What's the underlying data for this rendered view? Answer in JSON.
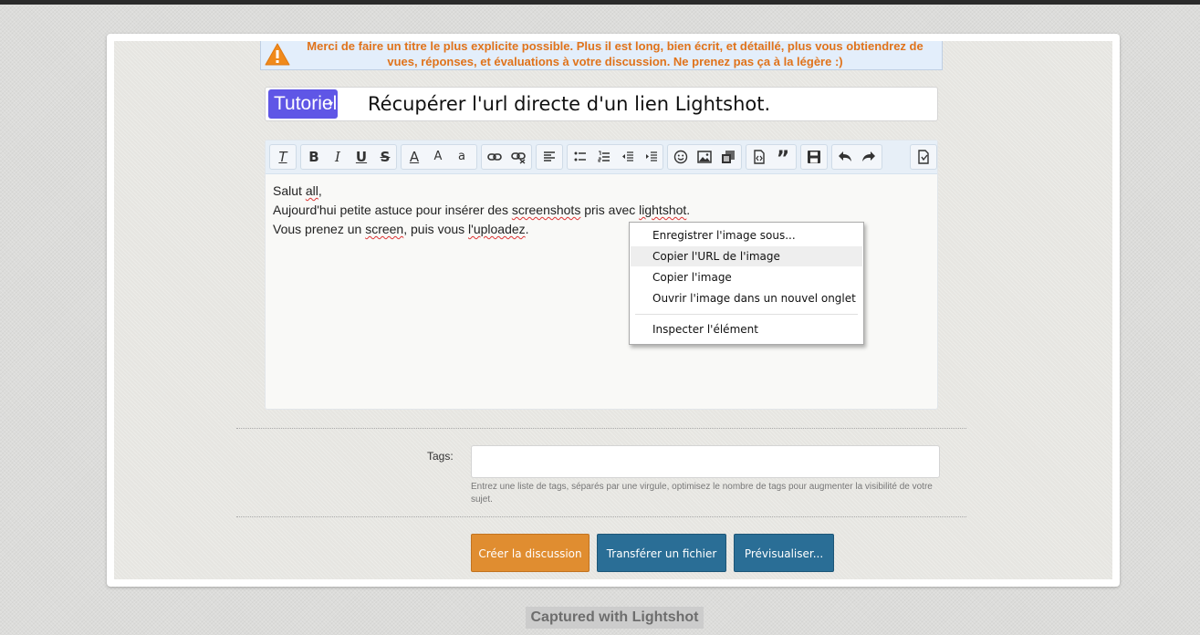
{
  "warning": {
    "icon": "warning-triangle-icon",
    "line1": "Merci de faire un titre le plus explicite possible. Plus il est long, bien écrit, et détaillé, plus vous obtiendrez de",
    "line2": "vues, réponses, et évaluations à votre discussion. Ne prenez pas ça à la légère :)",
    "color": "#e0731b"
  },
  "thread": {
    "prefix": "Tutoriel",
    "title": "Récupérer l'url directe d'un lien Lightshot."
  },
  "editor": {
    "toolbar": {
      "remove_format": "T",
      "bold": "B",
      "italic": "I",
      "underline": "U",
      "strike": "S",
      "font_color": "A",
      "font_size": "A",
      "font_family": "a"
    },
    "body": {
      "line1_a": "Salut ",
      "line1_b": "all",
      "line1_c": ",",
      "line2_a": "Aujourd'hui petite astuce pour insérer des ",
      "line2_b": "screenshots",
      "line2_c": " pris avec ",
      "line2_d": "lightshot",
      "line2_e": ".",
      "line3_a": "Vous prenez un ",
      "line3_b": "screen",
      "line3_c": ", puis vous ",
      "line3_d": "l'uploadez",
      "line3_e": "."
    }
  },
  "context_menu": {
    "items": [
      "Enregistrer l'image sous...",
      "Copier l'URL de l'image",
      "Copier l'image",
      "Ouvrir l'image dans un nouvel onglet",
      "Inspecter l'élément"
    ],
    "highlighted_index": 1
  },
  "tags": {
    "label": "Tags:",
    "value": "",
    "hint": "Entrez une liste de tags, séparés par une virgule, optimisez le nombre de tags pour augmenter la visibilité de votre sujet."
  },
  "actions": {
    "create": "Créer la discussion",
    "upload": "Transférer un fichier",
    "preview": "Prévisualiser..."
  },
  "watermark": "Captured with Lightshot",
  "colors": {
    "prefix_bg": "#5f56e6",
    "create_btn": "#e08d30",
    "blue_btn": "#2a6e96"
  }
}
